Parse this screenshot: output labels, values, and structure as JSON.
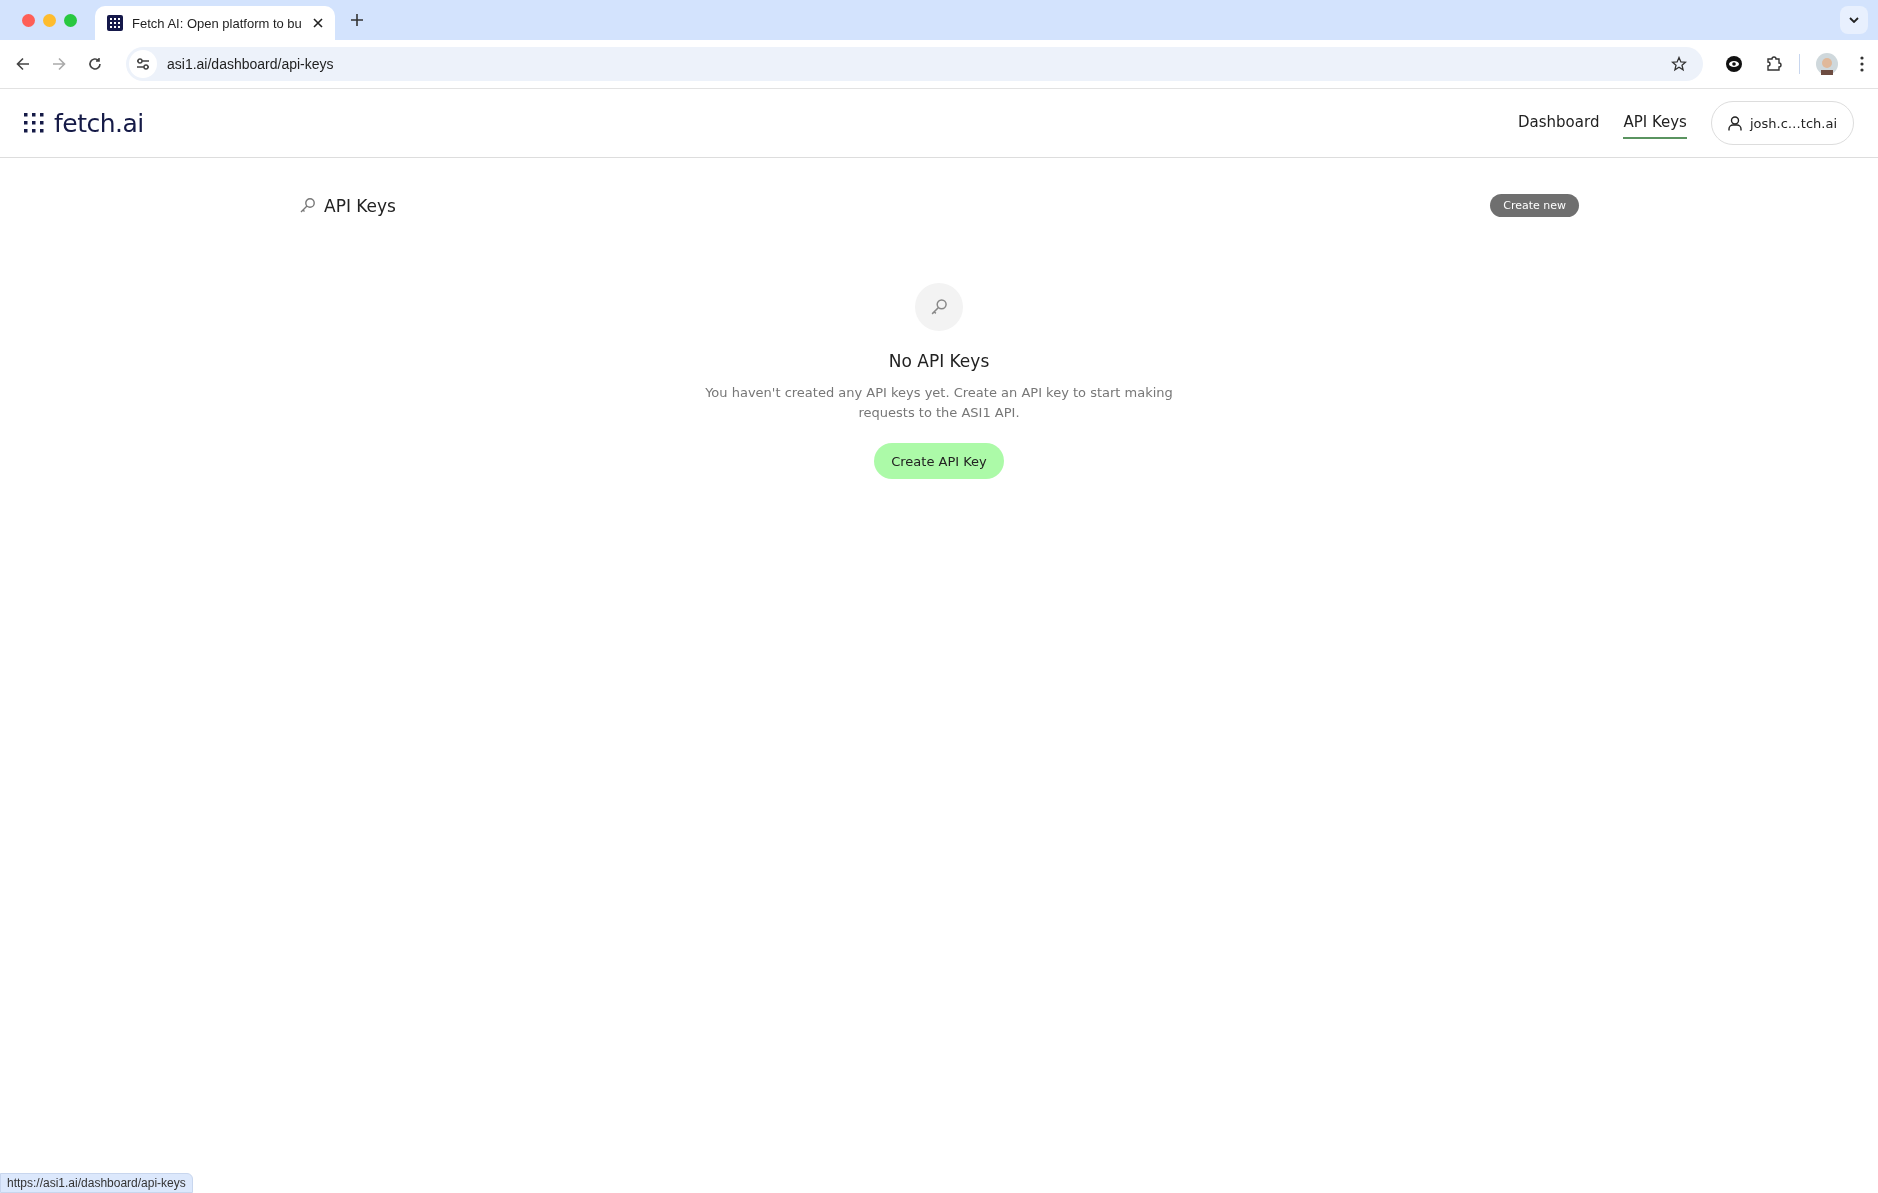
{
  "browser": {
    "tab_title": "Fetch AI: Open platform to bu",
    "url": "asi1.ai/dashboard/api-keys",
    "status_url": "https://asi1.ai/dashboard/api-keys"
  },
  "header": {
    "logo": "fetch.ai",
    "nav": [
      {
        "label": "Dashboard",
        "selected": false
      },
      {
        "label": "API Keys",
        "selected": true
      }
    ],
    "user": "josh.c…tch.ai"
  },
  "page": {
    "title": "API Keys",
    "create_button": "Create new"
  },
  "empty_state": {
    "title": "No API Keys",
    "message": "You haven't created any API keys yet. Create an API key to start making requests to the ASI1 API.",
    "button": "Create API Key"
  }
}
